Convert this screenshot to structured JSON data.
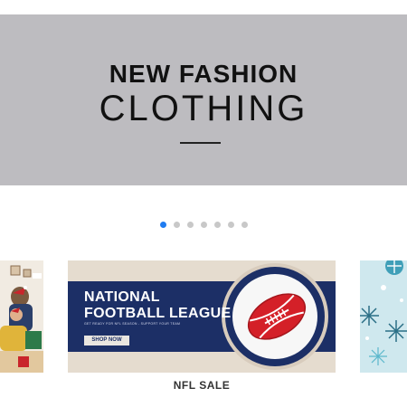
{
  "hero": {
    "line1": "NEW FASHION",
    "line2": "CLOTHING"
  },
  "carousel": {
    "dot_count": 7,
    "active_index": 0
  },
  "cards": {
    "main": {
      "title_line1": "NATIONAL",
      "title_line2": "FOOTBALL LEAGUE",
      "tagline": "GET READY FOR NFL SEASON - SUPPORT YOUR TEAM",
      "button_label": "SHOP NOW",
      "caption": "NFL SALE"
    }
  },
  "colors": {
    "active_dot": "#1f7cf1",
    "inactive_dot": "#c8c8c8",
    "nfl_navy": "#1c2f66",
    "football_red": "#d42028",
    "hero_bg": "#bdbcc0"
  }
}
